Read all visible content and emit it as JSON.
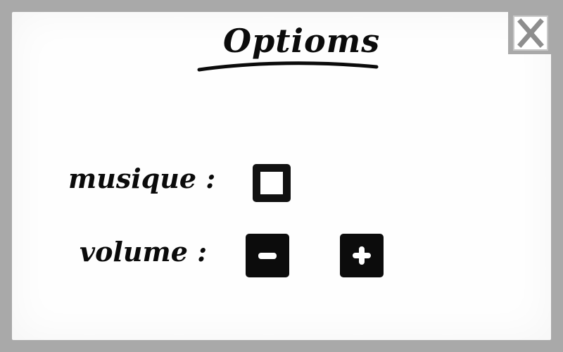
{
  "dialog": {
    "title": "Optioms",
    "close_icon": "close-x-icon"
  },
  "options": {
    "music": {
      "label": "musique :",
      "checked": false
    },
    "volume": {
      "label": "volume :",
      "decrease_icon": "minus-icon",
      "increase_icon": "plus-icon"
    }
  },
  "colors": {
    "frame": "#a9a9a9",
    "panel": "#fefefe",
    "ink": "#0b0b0b"
  }
}
